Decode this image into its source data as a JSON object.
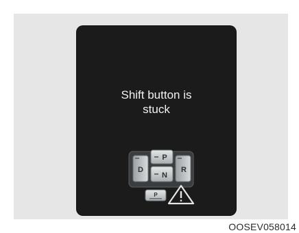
{
  "display": {
    "message_line1": "Shift button is",
    "message_line2": "stuck"
  },
  "shifter": {
    "buttons": {
      "drive": "D",
      "park": "P",
      "neutral": "N",
      "reverse": "R",
      "p_release": "P"
    },
    "warning_icon": "warning-triangle-icon"
  },
  "caption": {
    "code": "OOSEV058014"
  },
  "colors": {
    "screen": "#1b1b1b",
    "text": "#f2f2f2",
    "button_face": "#bfc4c6"
  }
}
